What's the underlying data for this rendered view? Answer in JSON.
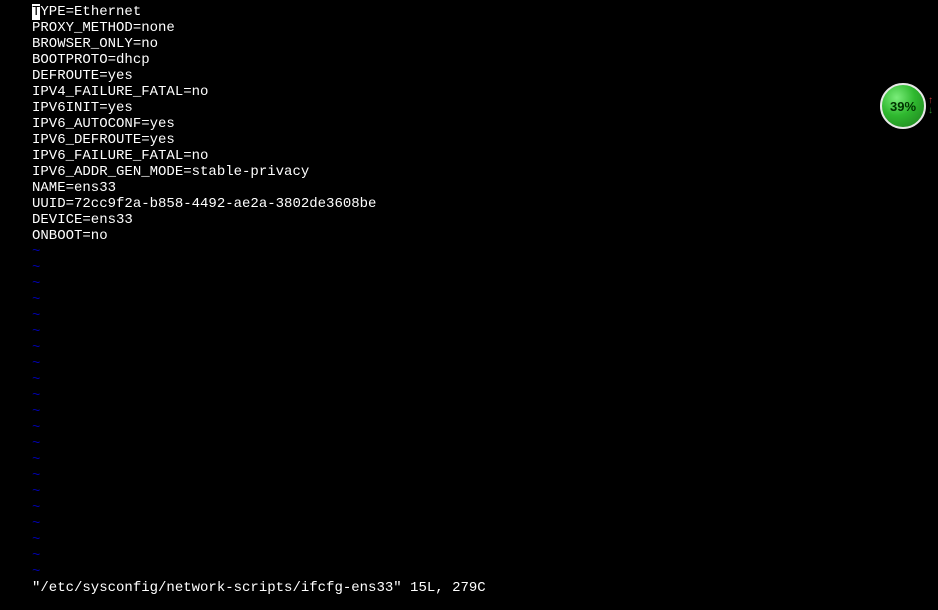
{
  "content_lines": [
    "TYPE=Ethernet",
    "PROXY_METHOD=none",
    "BROWSER_ONLY=no",
    "BOOTPROTO=dhcp",
    "DEFROUTE=yes",
    "IPV4_FAILURE_FATAL=no",
    "IPV6INIT=yes",
    "IPV6_AUTOCONF=yes",
    "IPV6_DEFROUTE=yes",
    "IPV6_FAILURE_FATAL=no",
    "IPV6_ADDR_GEN_MODE=stable-privacy",
    "NAME=ens33",
    "UUID=72cc9f2a-b858-4492-ae2a-3802de3608be",
    "DEVICE=ens33",
    "ONBOOT=no"
  ],
  "tilde_count": 21,
  "status_line": "\"/etc/sysconfig/network-scripts/ifcfg-ens33\" 15L, 279C",
  "badge": {
    "percent": "39%"
  },
  "cursor_line_index": 0
}
